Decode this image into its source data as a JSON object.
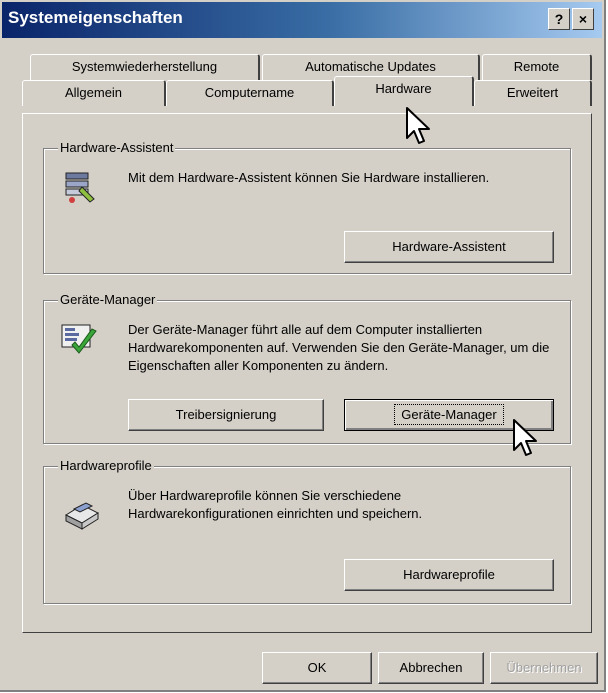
{
  "window": {
    "title": "Systemeigenschaften",
    "help_btn": "?",
    "close_btn": "×"
  },
  "tabs_row1": [
    "Systemwiederherstellung",
    "Automatische Updates",
    "Remote"
  ],
  "tabs_row2": [
    "Allgemein",
    "Computername",
    "Hardware",
    "Erweitert"
  ],
  "active_tab": "Hardware",
  "groups": {
    "assistant": {
      "label": "Hardware-Assistent",
      "desc": "Mit dem Hardware-Assistent können Sie Hardware installieren.",
      "button": "Hardware-Assistent",
      "icon": "hardware-assistant-icon"
    },
    "devmgr": {
      "label": "Geräte-Manager",
      "desc": "Der Geräte-Manager führt alle auf dem Computer installierten Hardwarekomponenten auf. Verwenden Sie den Geräte-Manager, um die Eigenschaften aller Komponenten zu ändern.",
      "button_sign": "Treibersignierung",
      "button_devmgr": "Geräte-Manager",
      "icon": "device-manager-icon"
    },
    "profiles": {
      "label": "Hardwareprofile",
      "desc": "Über Hardwareprofile können Sie verschiedene Hardwarekonfigurationen einrichten und speichern.",
      "button": "Hardwareprofile",
      "icon": "hardware-profile-icon"
    }
  },
  "footer": {
    "ok": "OK",
    "cancel": "Abbrechen",
    "apply": "Übernehmen"
  }
}
